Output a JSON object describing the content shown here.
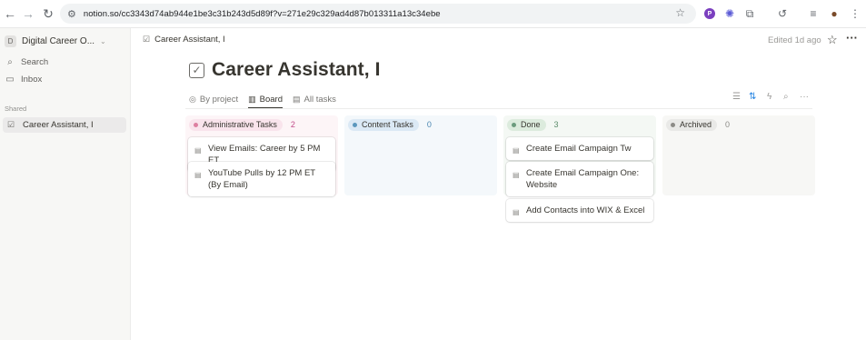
{
  "browser": {
    "url": "notion.so/cc3343d74ab944e1be3c31b243d5d89f?v=271e29c329ad4d87b013311a13c34ebe",
    "profile_initial": "P"
  },
  "sidebar": {
    "workspace_initial": "D",
    "workspace_name": "Digital Career O...",
    "search_label": "Search",
    "inbox_label": "Inbox",
    "shared_label": "Shared",
    "shared_item": "Career Assistant, I"
  },
  "topbar": {
    "breadcrumb": "Career Assistant, I",
    "edited": "Edited 1d ago"
  },
  "page": {
    "title": "Career Assistant, I",
    "tabs": [
      {
        "label": "By project",
        "active": false
      },
      {
        "label": "Board",
        "active": true
      },
      {
        "label": "All tasks",
        "active": false
      }
    ]
  },
  "board": {
    "columns": [
      {
        "label": "Administrative Tasks",
        "count": "2",
        "bg": "#fdf5f7",
        "pill": "#f9e4ec",
        "dot": "#dd7fa0",
        "count_color": "#c14c8a",
        "cards": [
          "View Emails: Career by 5 PM ET",
          "YouTube Pulls by 12 PM ET (By Email)"
        ]
      },
      {
        "label": "Content Tasks",
        "count": "0",
        "bg": "#f4f8fb",
        "pill": "#dbe9f5",
        "dot": "#5b97bd",
        "count_color": "#4a86b0",
        "cards": []
      },
      {
        "label": "Done",
        "count": "3",
        "bg": "#f4f8f4",
        "pill": "#dcebdd",
        "dot": "#6c9b7d",
        "count_color": "#5b8c6b",
        "cards": [
          "Create Email Campaign Tw",
          "Create Email Campaign One: Website",
          "Add Contacts into WIX & Excel"
        ]
      },
      {
        "label": "Archived",
        "count": "0",
        "bg": "#f7f7f5",
        "pill": "#e9e9e7",
        "dot": "#8c8b87",
        "count_color": "#8c8b87",
        "cards": []
      }
    ]
  }
}
